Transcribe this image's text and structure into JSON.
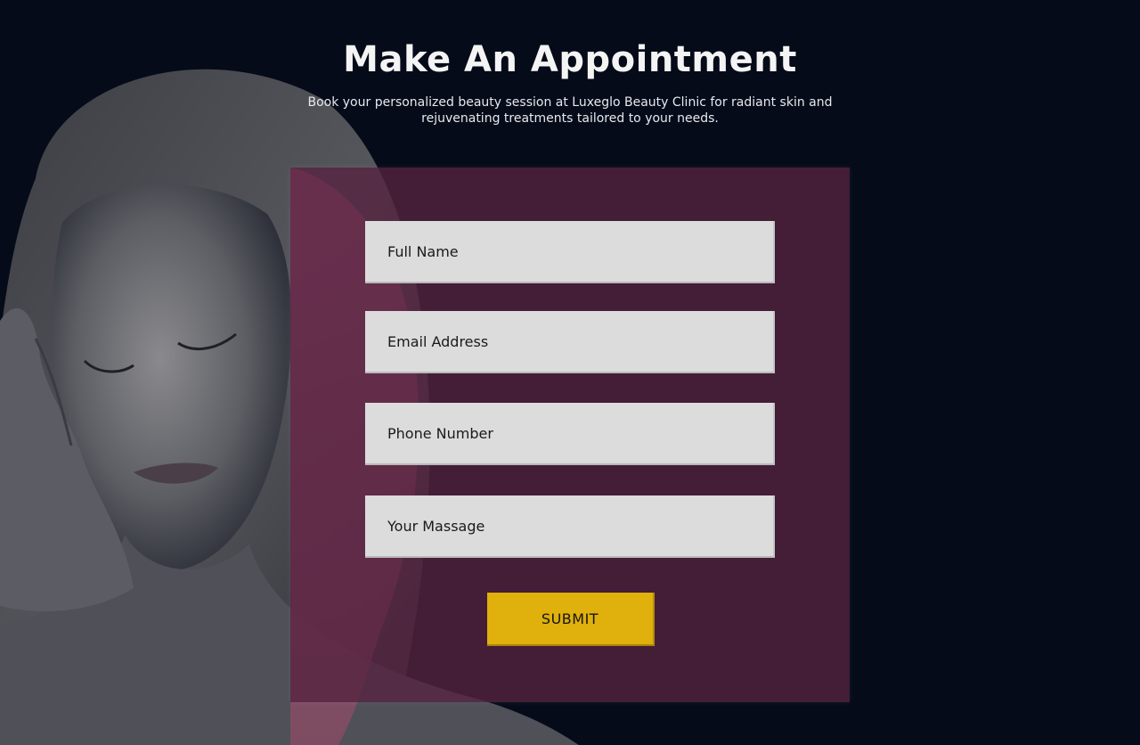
{
  "header": {
    "title": "Make An Appointment",
    "subtitle": "Book your personalized beauty session at Luxeglo Beauty Clinic for radiant skin and rejuvenating treatments tailored to your needs."
  },
  "form": {
    "full_name_placeholder": "Full Name",
    "email_placeholder": "Email Address",
    "phone_placeholder": "Phone Number",
    "message_placeholder": "Your Massage",
    "submit_label": "SUBMIT"
  },
  "colors": {
    "background": "#050b19",
    "panel": "#562240",
    "field": "#dcdcdc",
    "submit": "#e0b00c",
    "hair_highlight": "#d96a8e"
  }
}
